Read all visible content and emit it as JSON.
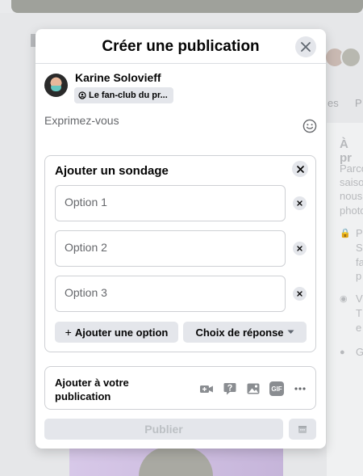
{
  "modal": {
    "title": "Créer une publication",
    "close_icon": "close-icon"
  },
  "author": {
    "name": "Karine Solovieff",
    "audience": "Le fan-club du pr..."
  },
  "composer": {
    "placeholder": "Exprimez-vous",
    "emoji_icon": "smiley-icon"
  },
  "poll": {
    "title": "Ajouter un sondage",
    "options": [
      "Option 1",
      "Option 2",
      "Option 3"
    ],
    "add_option_label": "Ajouter une option",
    "response_choice_label": "Choix de réponse"
  },
  "add_to_post": {
    "label": "Ajouter à votre publication",
    "tools": [
      "video-add-icon",
      "question-icon",
      "photo-tag-icon",
      "gif-icon",
      "more-icon"
    ],
    "gif_text": "GIF"
  },
  "publish_label": "Publier",
  "background": {
    "tab_fragments": [
      "es",
      "P"
    ],
    "side_title": "À pr",
    "side_lines": [
      "Parco",
      "saiso",
      "nous",
      "photo"
    ],
    "side_items": [
      {
        "icon": "lock-icon",
        "lines": [
          "P",
          "S",
          "fa",
          "p"
        ]
      },
      {
        "icon": "eye-icon",
        "lines": [
          "V",
          "T",
          "e"
        ]
      },
      {
        "icon": "group-icon",
        "lines": [
          "G"
        ]
      }
    ]
  }
}
